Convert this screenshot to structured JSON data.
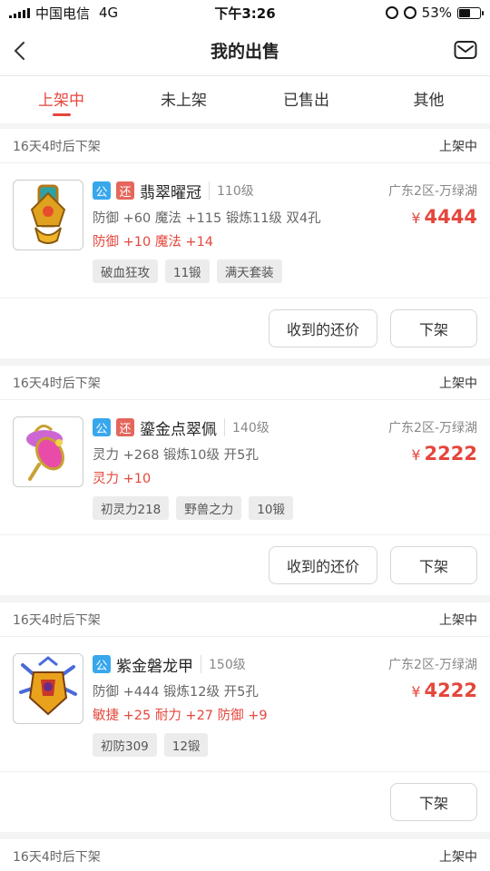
{
  "status_bar": {
    "carrier": "中国电信",
    "network": "4G",
    "time": "下午3:26",
    "battery": "53%",
    "battery_level": 0.53
  },
  "header": {
    "title": "我的出售"
  },
  "tabs": [
    {
      "label": "上架中",
      "active": true
    },
    {
      "label": "未上架",
      "active": false
    },
    {
      "label": "已售出",
      "active": false
    },
    {
      "label": "其他",
      "active": false
    }
  ],
  "listings": [
    {
      "timer": "16天4时后下架",
      "status": "上架中",
      "public_tag": "公",
      "bargain_tag": "还",
      "name": "翡翠曜冠",
      "level": "110级",
      "server": "广东2区-万绿湖",
      "attributes": "防御 +60 魔法 +115 锻炼11级 双4孔",
      "price": "4444",
      "currency": "¥",
      "bonus": "防御 +10 魔法 +14",
      "chips": [
        "破血狂攻",
        "11锻",
        "满天套装"
      ],
      "offer_label": "收到的还价",
      "delist_label": "下架",
      "icon": "crown-item-icon"
    },
    {
      "timer": "16天4时后下架",
      "status": "上架中",
      "public_tag": "公",
      "bargain_tag": "还",
      "name": "鎏金点翠佩",
      "level": "140级",
      "server": "广东2区-万绿湖",
      "attributes": "灵力 +268 锻炼10级 开5孔",
      "price": "2222",
      "currency": "¥",
      "bonus": "灵力 +10",
      "chips": [
        "初灵力218",
        "野兽之力",
        "10锻"
      ],
      "offer_label": "收到的还价",
      "delist_label": "下架",
      "icon": "pendant-item-icon"
    },
    {
      "timer": "16天4时后下架",
      "status": "上架中",
      "public_tag": "公",
      "bargain_tag": "",
      "name": "紫金磐龙甲",
      "level": "150级",
      "server": "广东2区-万绿湖",
      "attributes": "防御 +444 锻炼12级 开5孔",
      "price": "4222",
      "currency": "¥",
      "bonus": "敏捷 +25 耐力 +27 防御 +9",
      "chips": [
        "初防309",
        "12锻"
      ],
      "offer_label": "",
      "delist_label": "下架",
      "icon": "armor-item-icon"
    }
  ],
  "next_card_peek": {
    "timer": "16天4时后下架",
    "status": "上架中"
  },
  "colors": {
    "accent": "#e5463c",
    "public_tag": "#38a7ec",
    "bargain_tag": "#e5665c"
  }
}
